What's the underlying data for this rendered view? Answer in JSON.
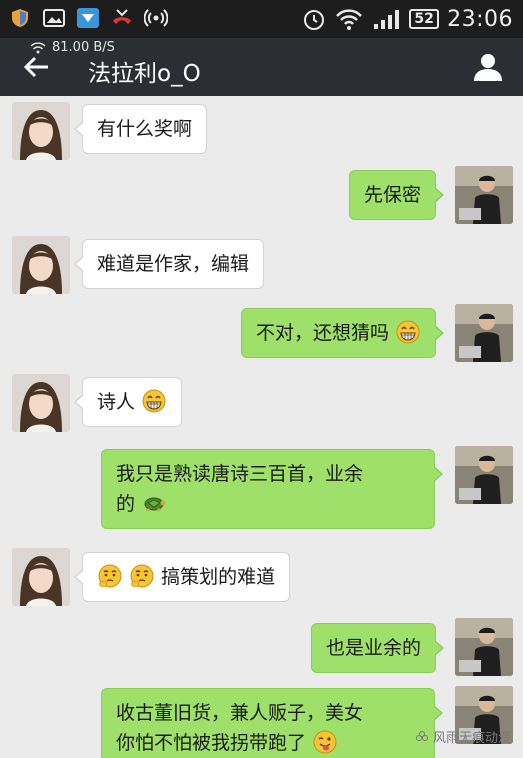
{
  "status_bar": {
    "time": "23:06",
    "battery": "52",
    "net_speed": "81.00 B/S"
  },
  "header": {
    "title": "法拉利o_O",
    "back_icon": "back-arrow-icon",
    "profile_icon": "person-icon"
  },
  "colors": {
    "sent_bubble": "#9fe06a",
    "received_bubble": "#ffffff",
    "chat_background": "#ebebeb",
    "header_bar": "#2b2f33"
  },
  "messages": [
    {
      "from": "her",
      "text": "有什么奖啊"
    },
    {
      "from": "me",
      "text": "先保密"
    },
    {
      "from": "her",
      "text": "难道是作家，编辑"
    },
    {
      "from": "me",
      "text": "不对，还想猜吗",
      "emoji_after": "grin-emoji"
    },
    {
      "from": "her",
      "text": "诗人",
      "emoji_after": "grin-emoji"
    },
    {
      "from": "me",
      "line1": "我只是熟读唐诗三百首，业余",
      "line2": "的",
      "emoji_after": "turtle-emoji"
    },
    {
      "from": "her",
      "emoji_before": [
        "thinking-emoji",
        "thinking-emoji"
      ],
      "text": "搞策划的难道"
    },
    {
      "from": "me",
      "text": "也是业余的"
    },
    {
      "from": "me",
      "line1": "收古董旧货，兼人贩子，美女",
      "line2": "你怕不怕被我拐带跑了",
      "emoji_after": "wink-tongue-emoji"
    }
  ],
  "watermark": "风雨无痕动漫"
}
